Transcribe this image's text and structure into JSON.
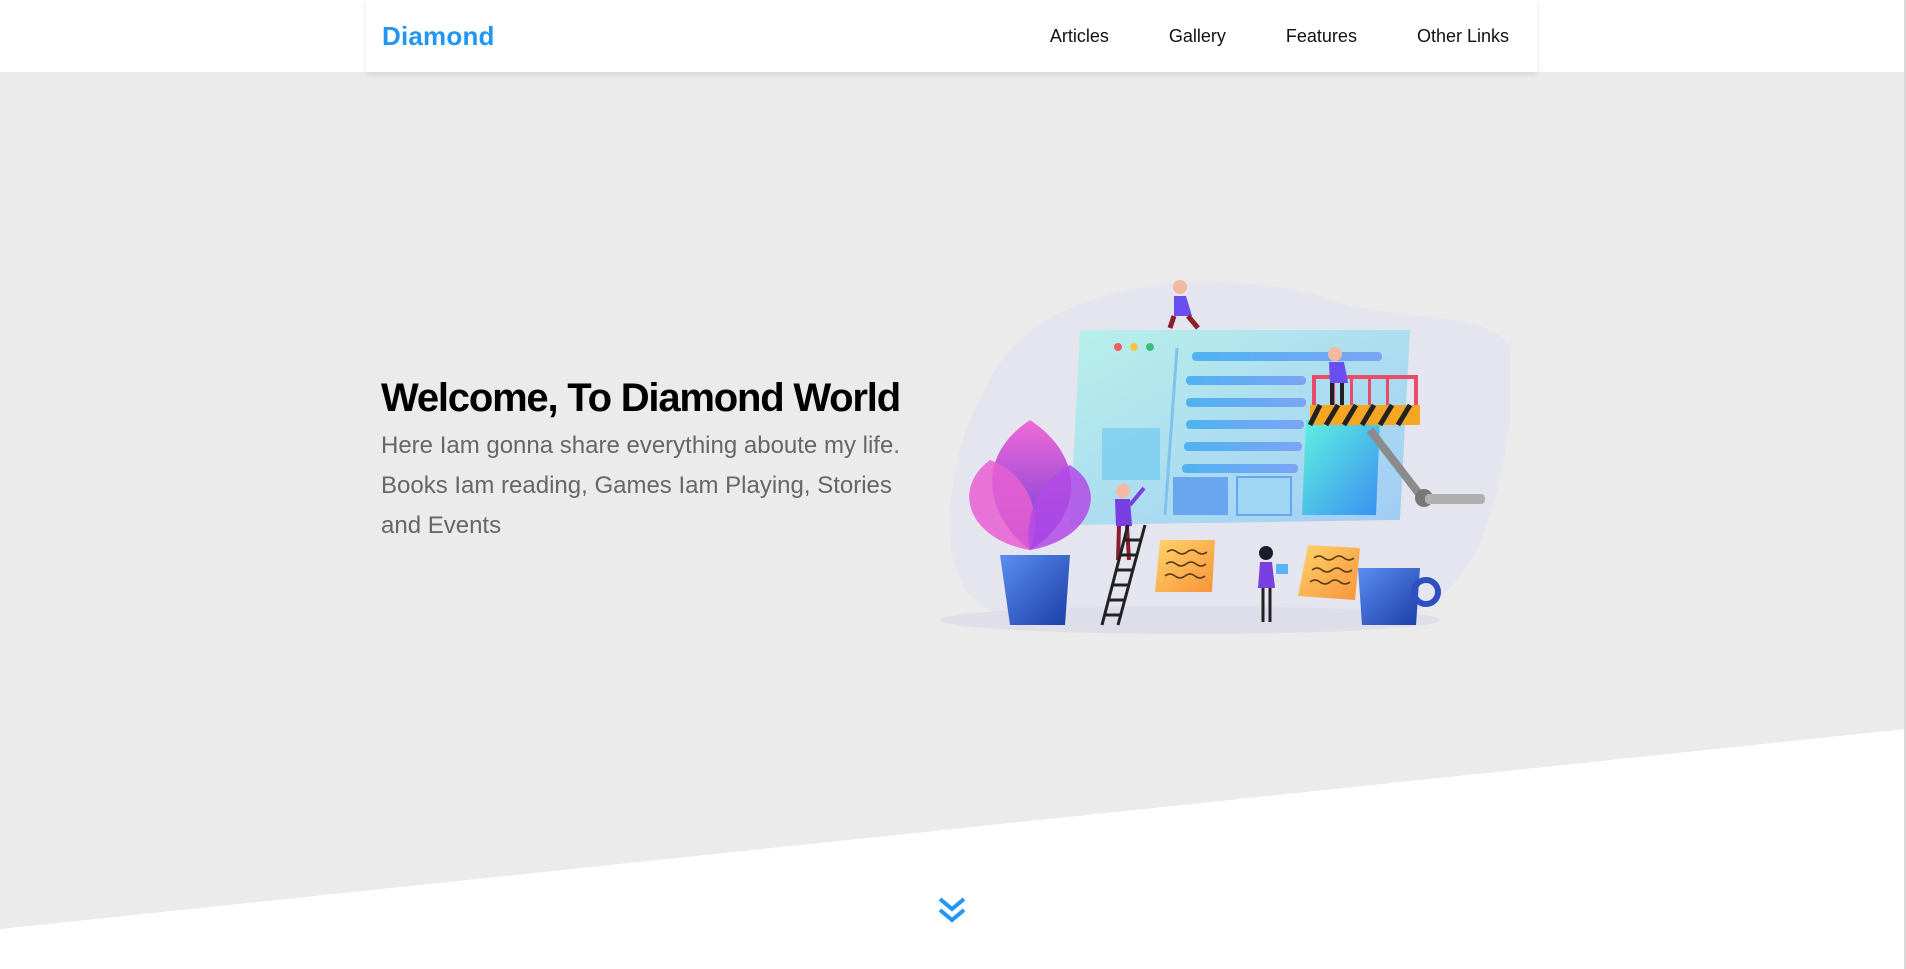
{
  "header": {
    "logo": "Diamond",
    "nav": [
      "Articles",
      "Gallery",
      "Features",
      "Other Links"
    ]
  },
  "hero": {
    "title": "Welcome, To Diamond World",
    "subtitle": "Here Iam gonna share everything aboute my life. Books Iam reading, Games Iam Playing, Stories and Events"
  },
  "icons": {
    "illustration": "website-builders-illustration",
    "scroll": "double-chevron-down-icon"
  },
  "colors": {
    "accent": "#2196f3",
    "hero_bg": "#ebebeb",
    "title": "#000000",
    "subtitle": "#666666"
  }
}
